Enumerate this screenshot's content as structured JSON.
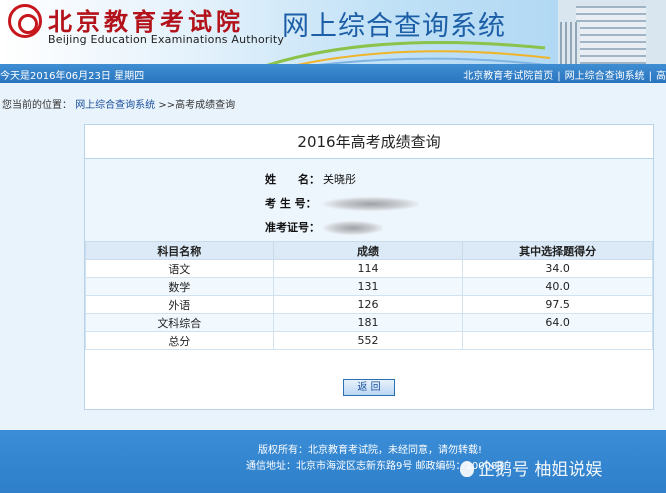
{
  "header": {
    "logo_cn": "北京教育考试院",
    "logo_en": "Beijing Education Examinations Authority",
    "system_title": "网上综合查询系统"
  },
  "navbar": {
    "date_text": "今天是2016年06月23日 星期四",
    "links": [
      "北京教育考试院首页",
      "网上综合查询系统"
    ]
  },
  "breadcrumb": {
    "prefix": "您当前的位置：",
    "items": [
      "网上综合查询系统",
      ">>高考成绩查询"
    ]
  },
  "panel": {
    "title": "2016年高考成绩查询",
    "info": {
      "name_label": "姓　　名：",
      "name_value": "关晓彤",
      "exam_no_label": "考 生 号：",
      "admission_label": "准考证号："
    },
    "table": {
      "headers": [
        "科目名称",
        "成绩",
        "其中选择题得分"
      ],
      "rows": [
        [
          "语文",
          "114",
          "34.0"
        ],
        [
          "数学",
          "131",
          "40.0"
        ],
        [
          "外语",
          "126",
          "97.5"
        ],
        [
          "文科综合",
          "181",
          "64.0"
        ],
        [
          "总分",
          "552",
          ""
        ]
      ]
    },
    "return_label": "返 回"
  },
  "footer": {
    "copyright": "版权所有：北京教育考试院，未经同意，请勿转载!",
    "address": "通信地址：北京市海淀区志新东路9号  邮政编码：100083"
  },
  "watermark": {
    "text": "企鹅号 柚姐说娱"
  },
  "colors": {
    "brand_red": "#b3121a",
    "brand_blue": "#1d5fa7",
    "nav_blue": "#2a74bf"
  }
}
